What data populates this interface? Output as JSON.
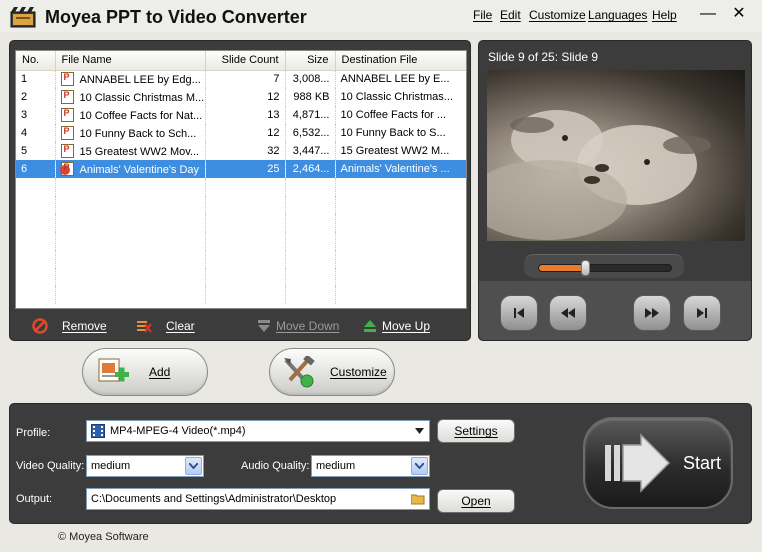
{
  "window": {
    "title": "Moyea PPT to Video Converter",
    "menu": [
      "File",
      "Edit",
      "Customize",
      "Languages",
      "Help"
    ],
    "minimize_glyph": "—",
    "close_glyph": "✕"
  },
  "file_list": {
    "columns": [
      "No.",
      "File Name",
      "Slide Count",
      "Size",
      "Destination File"
    ],
    "rows": [
      {
        "no": "1",
        "name": "ANNABEL LEE by Edg...",
        "slides": "7",
        "size": "3,008...",
        "dest": "ANNABEL LEE by E...",
        "selected": false
      },
      {
        "no": "2",
        "name": "10 Classic Christmas M...",
        "slides": "12",
        "size": "988 KB",
        "dest": "10 Classic Christmas...",
        "selected": false
      },
      {
        "no": "3",
        "name": "10 Coffee Facts for Nat...",
        "slides": "13",
        "size": "4,871...",
        "dest": "10 Coffee Facts for ...",
        "selected": false
      },
      {
        "no": "4",
        "name": "10 Funny Back to Sch...",
        "slides": "12",
        "size": "6,532...",
        "dest": "10 Funny Back to S...",
        "selected": false
      },
      {
        "no": "5",
        "name": "15 Greatest WW2 Mov...",
        "slides": "32",
        "size": "3,447...",
        "dest": "15 Greatest WW2 M...",
        "selected": false
      },
      {
        "no": "6",
        "name": "Animals' Valentine's Day",
        "slides": "25",
        "size": "2,464...",
        "dest": "Animals' Valentine's ...",
        "selected": true
      }
    ]
  },
  "list_toolbar": {
    "remove": "Remove",
    "clear": "Clear",
    "move_down": "Move Down",
    "move_up": "Move Up"
  },
  "preview": {
    "caption": "Slide 9 of 25: Slide 9",
    "progress": 0.35
  },
  "actions": {
    "add": "Add",
    "customize": "Customize"
  },
  "settings": {
    "profile_label": "Profile:",
    "profile_value": "MP4-MPEG-4 Video(*.mp4)",
    "settings_button": "Settings",
    "video_quality_label": "Video Quality:",
    "video_quality_value": "medium",
    "audio_quality_label": "Audio Quality:",
    "audio_quality_value": "medium",
    "output_label": "Output:",
    "output_value": "C:\\Documents and Settings\\Administrator\\Desktop",
    "open_button": "Open",
    "start_button": "Start"
  },
  "footer": {
    "copyright": "© Moyea Software"
  },
  "colors": {
    "panel": "#3c3c3c",
    "selection": "#3d8ee0",
    "seek_fill": "#e87b2c"
  }
}
